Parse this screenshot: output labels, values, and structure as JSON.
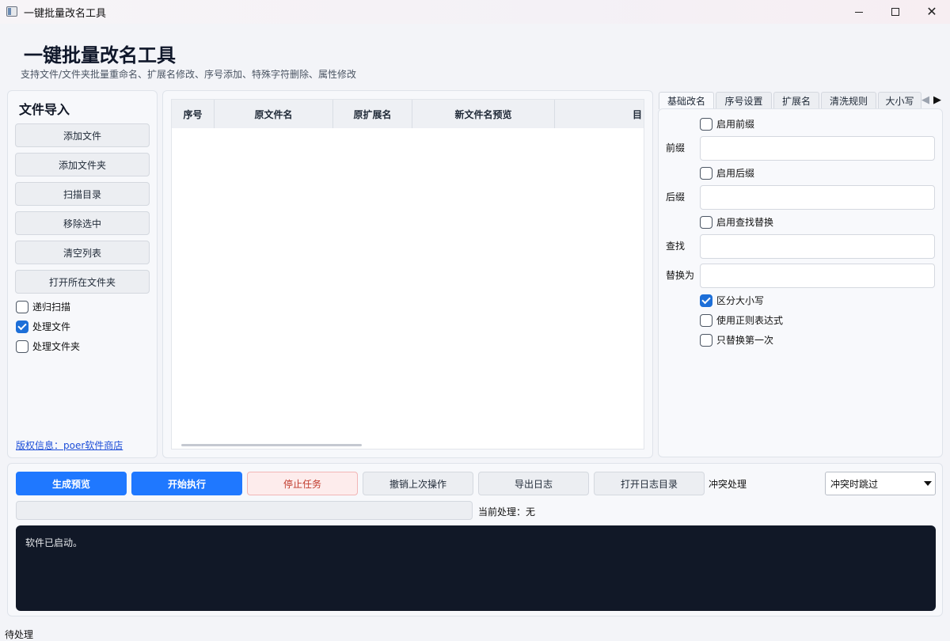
{
  "window": {
    "title": "一键批量改名工具"
  },
  "header": {
    "title": "一键批量改名工具",
    "subtitle": "支持文件/文件夹批量重命名、扩展名修改、序号添加、特殊字符删除、属性修改"
  },
  "import_panel": {
    "title": "文件导入",
    "buttons": [
      "添加文件",
      "添加文件夹",
      "扫描目录",
      "移除选中",
      "清空列表",
      "打开所在文件夹"
    ],
    "options": [
      {
        "label": "递归扫描",
        "checked": false
      },
      {
        "label": "处理文件",
        "checked": true
      },
      {
        "label": "处理文件夹",
        "checked": false
      }
    ],
    "copyright": "版权信息：poer软件商店"
  },
  "file_table": {
    "columns": [
      "序号",
      "原文件名",
      "原扩展名",
      "新文件名预览",
      "目"
    ],
    "rows": []
  },
  "tabs": {
    "items": [
      "基础改名",
      "序号设置",
      "扩展名",
      "清洗规则",
      "大小写"
    ],
    "active": "基础改名",
    "prev_arrow": "◀",
    "next_arrow": "▶"
  },
  "basic_rename": {
    "enable_prefix": {
      "label": "启用前缀",
      "checked": false
    },
    "prefix_label": "前缀",
    "prefix_value": "",
    "enable_suffix": {
      "label": "启用后缀",
      "checked": false
    },
    "suffix_label": "后缀",
    "suffix_value": "",
    "enable_find_replace": {
      "label": "启用查找替换",
      "checked": false
    },
    "find_label": "查找",
    "find_value": "",
    "replace_label": "替换为",
    "replace_value": "",
    "case_sensitive": {
      "label": "区分大小写",
      "checked": true
    },
    "use_regex": {
      "label": "使用正则表达式",
      "checked": false
    },
    "replace_first_only": {
      "label": "只替换第一次",
      "checked": false
    }
  },
  "actions": {
    "generate_preview": "生成预览",
    "start": "开始执行",
    "stop": "停止任务",
    "undo": "撤销上次操作",
    "export_log": "导出日志",
    "open_log_dir": "打开日志目录",
    "conflict_label": "冲突处理",
    "conflict_value": "冲突时跳过"
  },
  "progress": {
    "value": 0,
    "current_label": "当前处理：无"
  },
  "log": {
    "text": "软件已启动。"
  },
  "statusbar": {
    "text": "待处理"
  },
  "colors": {
    "primary": "#1f78ff",
    "danger_text": "#c0392b",
    "danger_bg": "#fdecec",
    "checkbox_checked": "#1d6fd8",
    "log_bg": "#111827",
    "link": "#1d4ed8"
  }
}
